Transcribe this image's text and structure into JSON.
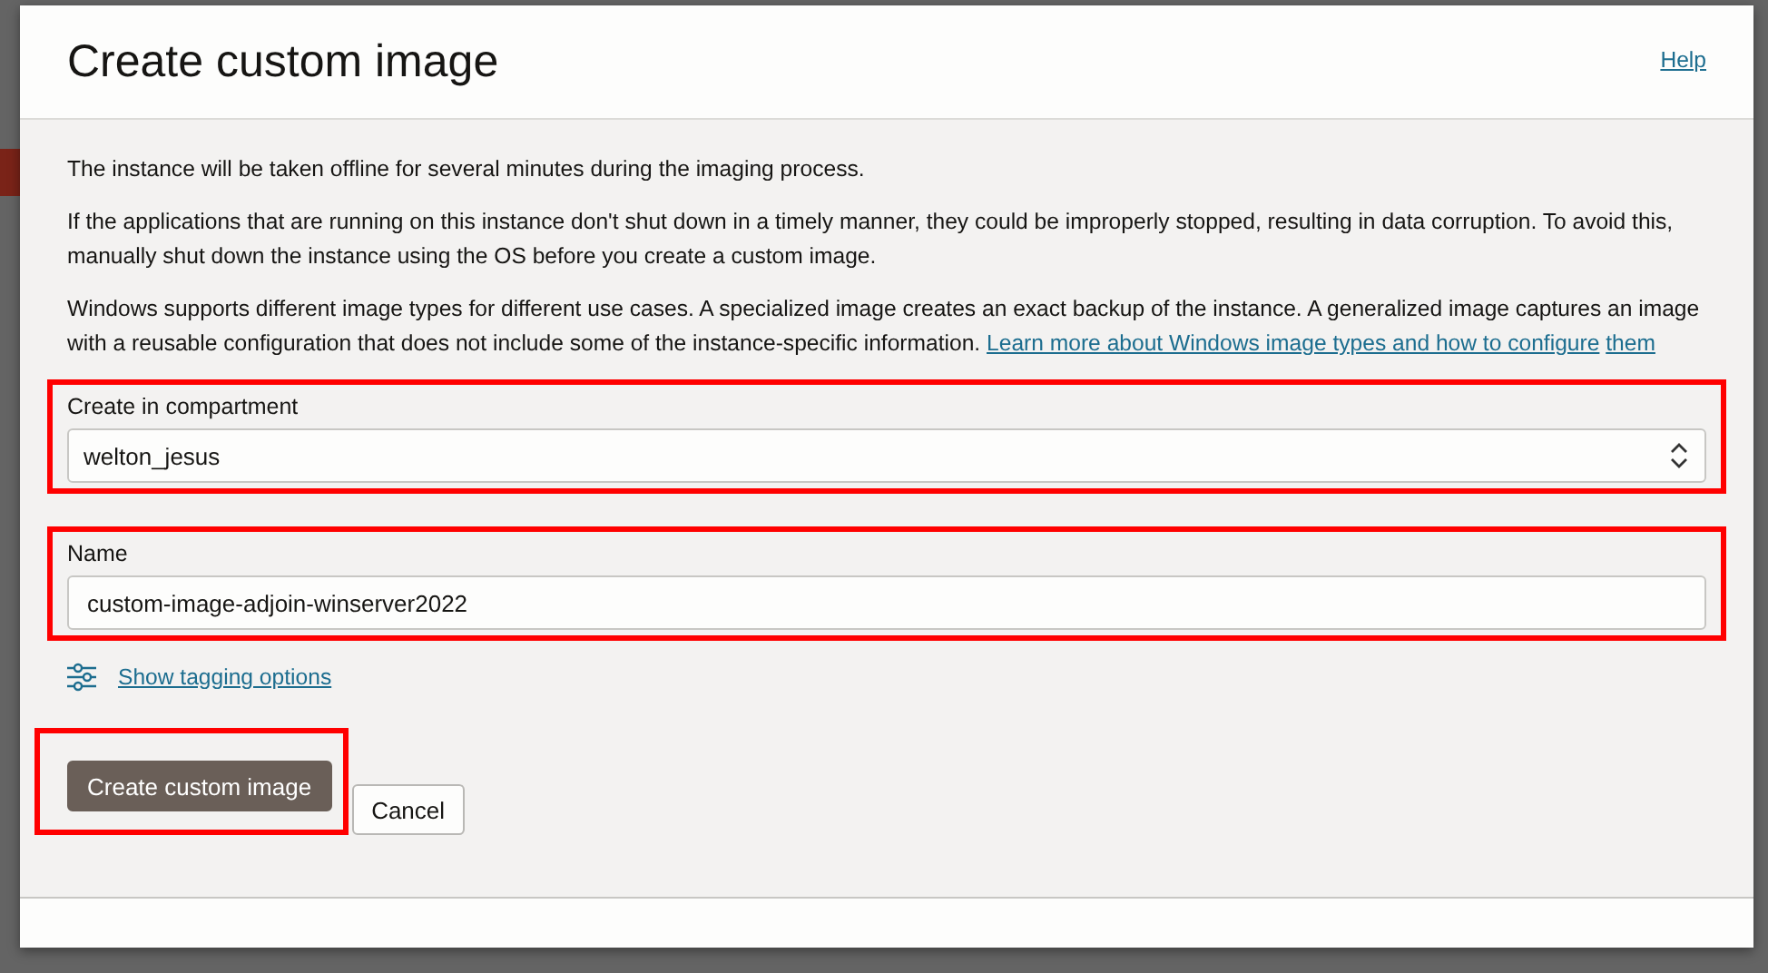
{
  "dialog": {
    "title": "Create custom image",
    "help_link": "Help",
    "paragraphs": [
      {
        "text": "The instance will be taken offline for several minutes during the imaging process."
      },
      {
        "text": "If the applications that are running on this instance don't shut down in a timely manner, they could be improperly stopped, resulting in data corruption. To avoid this, manually shut down the instance using the OS before you create a custom image."
      },
      {
        "text": "Windows supports different image types for different use cases. A specialized image creates an exact backup of the instance. A generalized image captures an image with a reusable configuration that does not include some of the instance-specific information.",
        "link_lines": [
          "Learn more about Windows image types and how to configure",
          "them"
        ]
      }
    ],
    "fields": [
      {
        "kind": "select",
        "label": "Create in compartment",
        "value": "welton_jesus",
        "highlighted": true
      },
      {
        "kind": "text",
        "label": "Name",
        "value": "custom-image-adjoin-winserver2022",
        "highlighted": true
      }
    ],
    "tagging_link": "Show tagging options",
    "buttons": [
      {
        "label": "Create custom image",
        "kind": "primary",
        "highlighted": true
      },
      {
        "label": "Cancel",
        "kind": "secondary",
        "highlighted": false
      }
    ]
  }
}
